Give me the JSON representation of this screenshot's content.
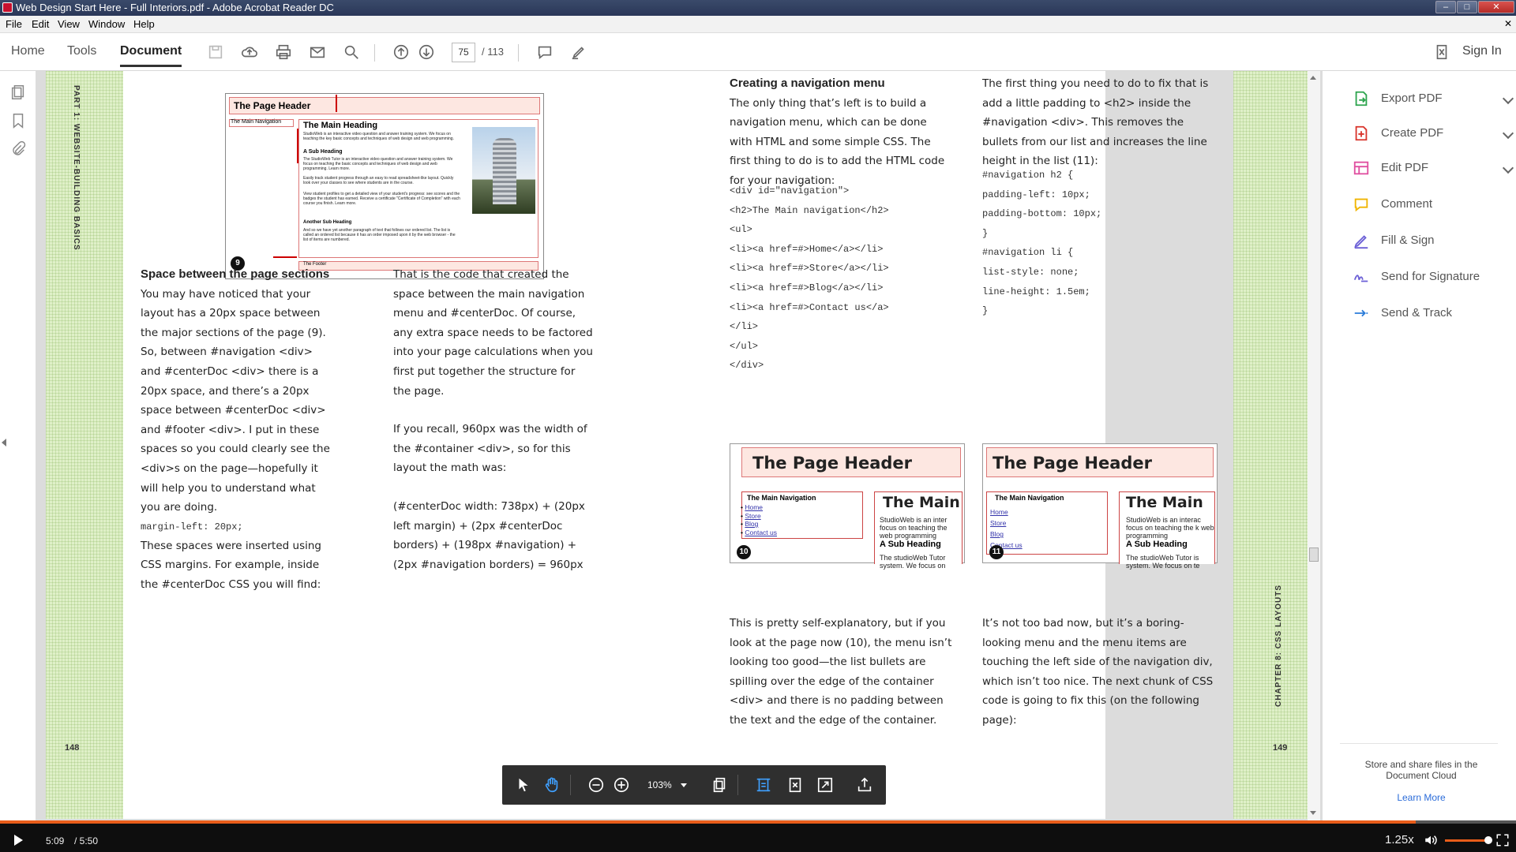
{
  "window": {
    "title": "Web Design Start Here - Full Interiors.pdf - Adobe Acrobat Reader DC",
    "min": "–",
    "max": "□",
    "close": "✕"
  },
  "menu": [
    "File",
    "Edit",
    "View",
    "Window",
    "Help"
  ],
  "toolbar": {
    "home": "Home",
    "tools": "Tools",
    "document": "Document",
    "page_current": "75",
    "page_total": "/ 113",
    "sign_in": "Sign In"
  },
  "left_page": {
    "runhead": "PART 1: WEBSITE-BUILDING BASICS",
    "page_number": "148",
    "fig9": {
      "header": "The Page Header",
      "nav": "The Main Navigation",
      "main": "The Main Heading",
      "sub1": "A Sub Heading",
      "sub2": "Another Sub Heading",
      "footer": "The Footer",
      "badge": "9",
      "body1": "StudioWeb is an interactive video question and answer training system. We focus on teaching the key basic concepts and techniques of web design and web programming.",
      "body2": "The StudioWeb Tutor is an interactive video question and answer training system. We focus on teaching the basic concepts and techniques of web design and web programming. Learn more.",
      "body3": "Easily track student progress through an easy to read spreadsheet-like layout. Quickly look over your classes to see where students are in the course.",
      "body4": "View student profiles to get a detailed view of your student's progress: see scores and the badges the student has earned. Receive a certificate \"Certificate of Completion\" with each course you finish. Learn more.",
      "body5": "And so we have yet another paragraph of text that follows our ordered list. The list is called an ordered list because it has an order imposed upon it by the web browser - the list of items are numbered."
    },
    "col1": {
      "heading": "Space between the page sections",
      "p1": "You may have noticed that your layout has a 20px space between the major sections of the page (9). So, between #navigation <div> and #centerDoc <div> there is a 20px space, and there’s a 20px space between #centerDoc <div> and #footer <div>. I put in these spaces so you could clearly see the <div>s on the page—hopefully it will help you to understand what you are doing.",
      "p2": "These spaces were inserted using CSS margins. For example, inside the #centerDoc CSS you will find:",
      "code": "margin-left: 20px;"
    },
    "col2": {
      "p1": "That is the code that created the space between the main navigation menu and #centerDoc. Of course, any extra space needs to be factored into your page calculations when you first put together the structure for the page.",
      "p2": "If you recall, 960px was the width of the #container <div>, so for this layout the math was:",
      "p3": "(#centerDoc width: 738px) + (20px left margin) + (2px #centerDoc borders) + (198px #navigation) + (2px #navigation borders) = 960px"
    }
  },
  "right_page": {
    "runhead": "CHAPTER 8: CSS LAYOUTS",
    "page_number": "149",
    "col1": {
      "heading": "Creating a navigation menu",
      "p1": "The only thing that’s left is to build a navigation menu, which can be done with HTML and some simple CSS. The first thing to do is to add the HTML code for your navigation:",
      "code": "<div id=\"navigation\">\n<h2>The Main navigation</h2>\n<ul>\n<li><a href=#>Home</a></li>\n<li><a href=#>Store</a></li>\n<li><a href=#>Blog</a></li>\n<li><a href=#>Contact us</a>\n</li>\n</ul>\n</div>",
      "p2": "This is pretty self-explanatory, but if you look at the page now (10), the menu isn’t looking too good—the list bullets are spilling over the edge of the container <div> and there is no padding between the text and the edge of the container."
    },
    "col2": {
      "p1": "The first thing you need to do to fix that is add a little padding to <h2> inside the #navigation <div>. This removes the bullets from our list and increases the line height in the list (11):",
      "code": "#navigation h2 {\npadding-left: 10px;\npadding-bottom: 10px;\n}\n#navigation li {\nlist-style: none;\nline-height: 1.5em;\n}",
      "p2": "It’s not too bad now, but it’s a boring-looking menu and the menu items are touching the left side of the navigation div, which isn’t too nice. The next chunk of CSS code is going to fix this (on the following page):"
    },
    "fig10": {
      "header": "The Page Header",
      "nav": "The Main Navigation",
      "links": [
        "Home",
        "Store",
        "Blog",
        "Contact us"
      ],
      "main": "The Main",
      "body": "StudioWeb is an inter focus on teaching the web programming",
      "sub": "A Sub Heading",
      "body2": "The studioWeb Tutor system. We focus on",
      "badge": "10"
    },
    "fig11": {
      "header": "The Page Header",
      "nav": "The Main Navigation",
      "links": [
        "Home",
        "Store",
        "Blog",
        "Contact us"
      ],
      "main": "The Main",
      "body": "StudioWeb is an interac focus on teaching the k web programming",
      "sub": "A Sub Heading",
      "body2": "The studioWeb Tutor is system. We focus on te",
      "badge": "11"
    }
  },
  "tools_panel": {
    "items": [
      {
        "label": "Export PDF",
        "color": "#2da44e",
        "expand": true
      },
      {
        "label": "Create PDF",
        "color": "#d9342b",
        "expand": true
      },
      {
        "label": "Edit PDF",
        "color": "#e04fa0",
        "expand": true
      },
      {
        "label": "Comment",
        "color": "#f0b400",
        "expand": false
      },
      {
        "label": "Fill & Sign",
        "color": "#6b5fd6",
        "expand": false
      },
      {
        "label": "Send for Signature",
        "color": "#6b5fd6",
        "expand": false
      },
      {
        "label": "Send & Track",
        "color": "#2b7cd9",
        "expand": false
      }
    ],
    "cloud_text": "Store and share files in the Document Cloud",
    "learn_more": "Learn More"
  },
  "floating_toolbar": {
    "zoom": "103%"
  },
  "video": {
    "time_current": "5:09",
    "time_total": "/ 5:50",
    "speed": "1.25x",
    "progress": 0.934
  },
  "colors": {
    "accent_video": "#e85d1a",
    "grid_green": "#dff0c8"
  }
}
